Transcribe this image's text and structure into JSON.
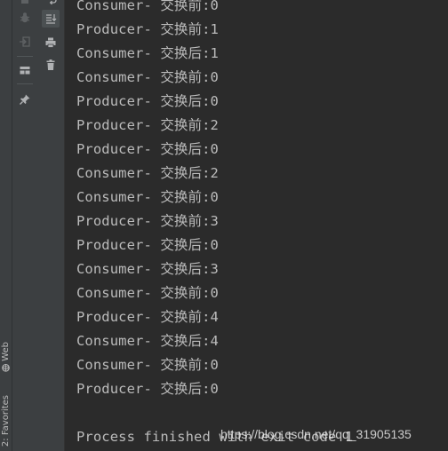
{
  "side_tabs": {
    "web": "Web",
    "favorites": "2: Favorites"
  },
  "console": {
    "lines": [
      "Consumer- 交换前:0",
      "Producer- 交换前:1",
      "Consumer- 交换后:1",
      "Consumer- 交换前:0",
      "Producer- 交换后:0",
      "Producer- 交换前:2",
      "Producer- 交换后:0",
      "Consumer- 交换后:2",
      "Consumer- 交换前:0",
      "Producer- 交换前:3",
      "Producer- 交换后:0",
      "Consumer- 交换后:3",
      "Consumer- 交换前:0",
      "Producer- 交换前:4",
      "Consumer- 交换后:4",
      "Consumer- 交换前:0",
      "Producer- 交换后:0"
    ],
    "exit_message": "Process finished with exit code 1"
  },
  "watermark": "https://blog.csdn.net/qq_31905135",
  "colors": {
    "console_bg": "#2b2b2b",
    "toolbar_bg": "#3c3f41",
    "text": "#bbbbbb",
    "icon": "#afb1b3",
    "icon_disabled": "#5e6163"
  }
}
